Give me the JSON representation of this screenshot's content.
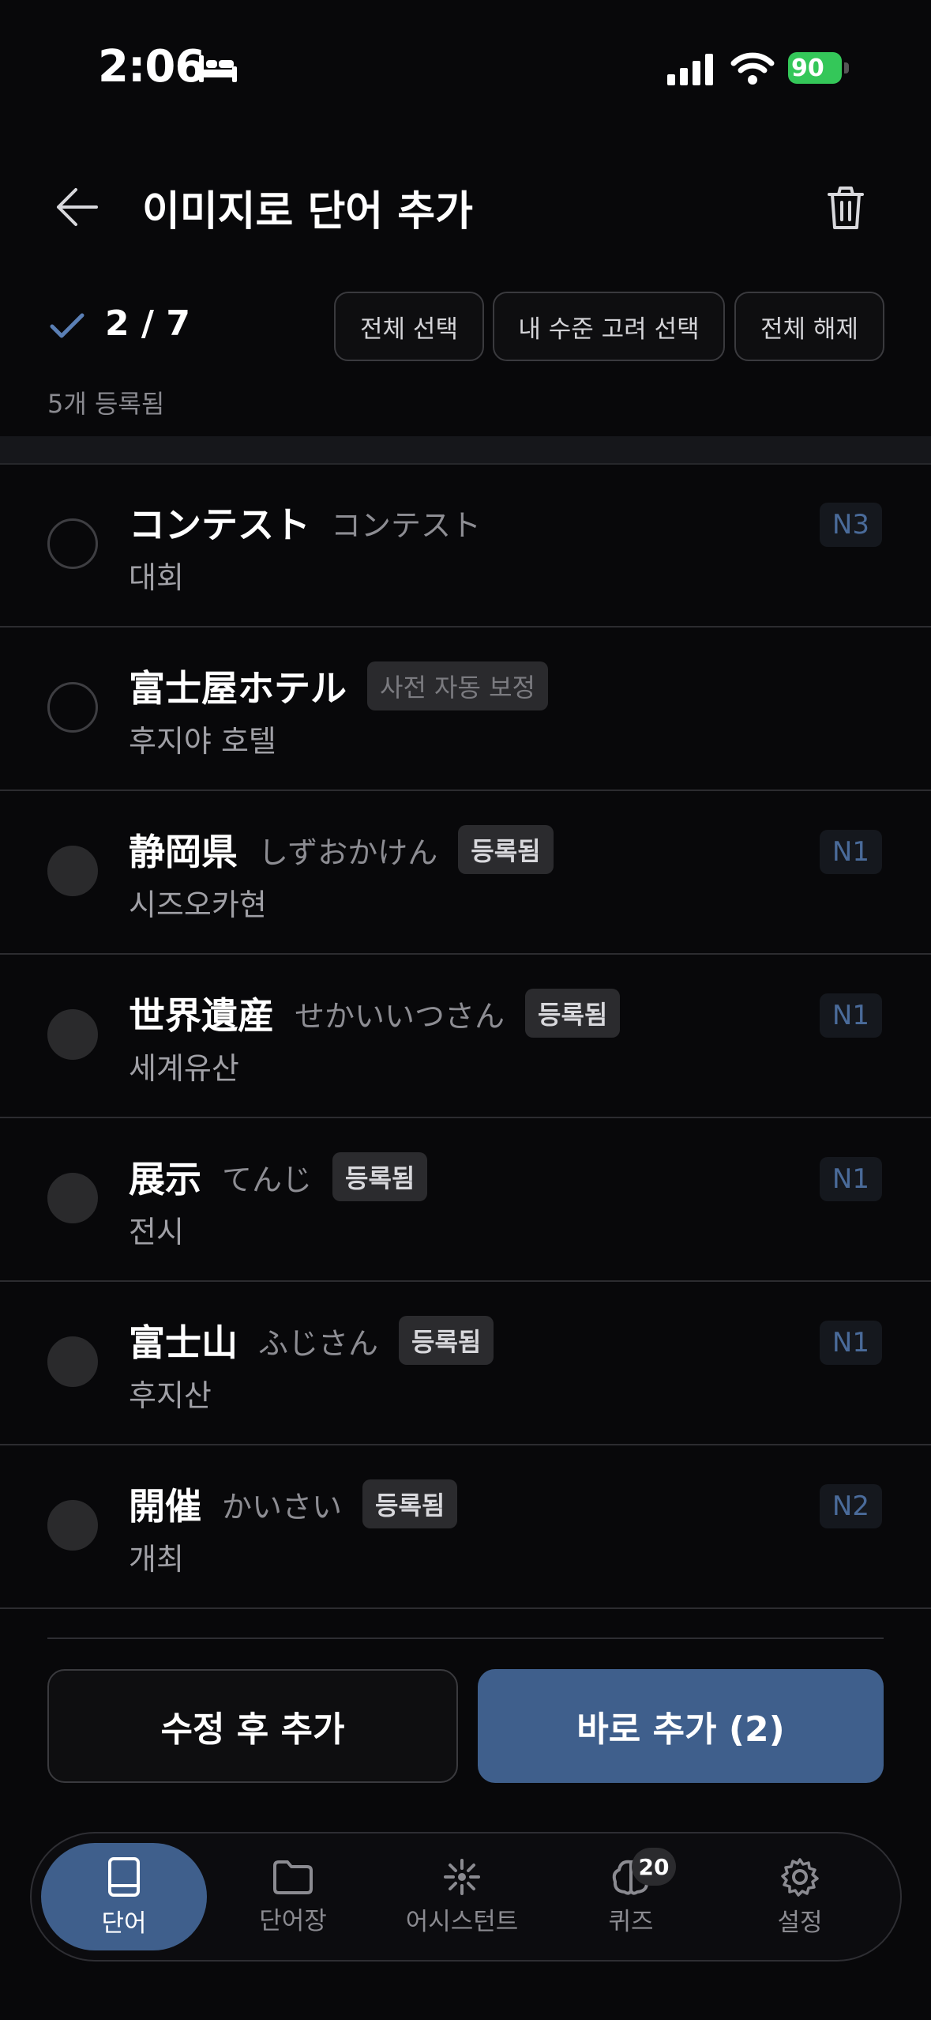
{
  "status_bar": {
    "time": "2:06",
    "battery": "90"
  },
  "header": {
    "title": "이미지로 단어 추가"
  },
  "selection": {
    "count": "2 / 7",
    "select_all": "전체 선택",
    "select_level": "내 수준 고려 선택",
    "deselect_all": "전체 해제",
    "registered_note": "5개 등록됨"
  },
  "words": [
    {
      "word": "コンテスト",
      "reading": "コンテスト",
      "tag": "",
      "meaning": "대회",
      "level": "N3"
    },
    {
      "word": "富士屋ホテル",
      "reading": "",
      "tag": "사전 자동 보정",
      "meaning": "후지야 호텔",
      "level": ""
    },
    {
      "word": "静岡県",
      "reading": "しずおかけん",
      "tag": "등록됨",
      "meaning": "시즈오카현",
      "level": "N1"
    },
    {
      "word": "世界遺産",
      "reading": "せかいいつさん",
      "tag": "등록됨",
      "meaning": "세계유산",
      "level": "N1"
    },
    {
      "word": "展示",
      "reading": "てんじ",
      "tag": "등록됨",
      "meaning": "전시",
      "level": "N1"
    },
    {
      "word": "富士山",
      "reading": "ふじさん",
      "tag": "등록됨",
      "meaning": "후지산",
      "level": "N1"
    },
    {
      "word": "開催",
      "reading": "かいさい",
      "tag": "등록됨",
      "meaning": "개최",
      "level": "N2"
    }
  ],
  "actions": {
    "edit_add": "수정 후 추가",
    "add_now": "바로 추가 (2)"
  },
  "tabs": [
    {
      "label": "단어",
      "icon": "book-icon"
    },
    {
      "label": "단어장",
      "icon": "folder-icon"
    },
    {
      "label": "어시스턴트",
      "icon": "sparkle-icon"
    },
    {
      "label": "퀴즈",
      "icon": "brain-icon",
      "badge": "20"
    },
    {
      "label": "설정",
      "icon": "gear-icon"
    }
  ],
  "colors": {
    "accent": "#3f5f8c",
    "background": "#08080a"
  }
}
